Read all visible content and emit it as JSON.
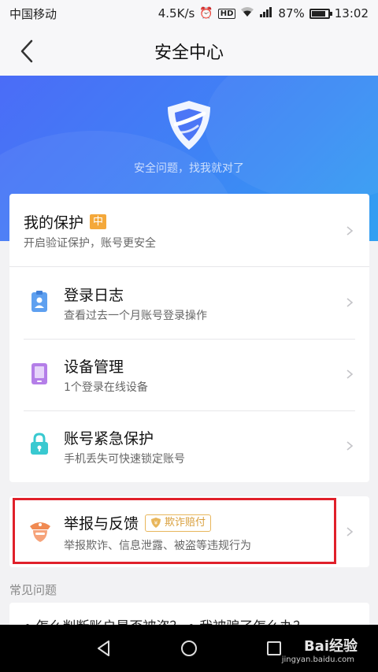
{
  "status_bar": {
    "carrier": "中国移动",
    "speed": "4.5K/s",
    "battery": "87%",
    "time": "13:02"
  },
  "header": {
    "title": "安全中心"
  },
  "hero": {
    "slogan": "安全问题，找我就对了"
  },
  "protection": {
    "title": "我的保护",
    "level_badge": "中",
    "subtitle": "开启验证保护，账号更安全"
  },
  "items": [
    {
      "title": "登录日志",
      "subtitle": "查看过去一个月账号登录操作",
      "icon": "login-log-icon",
      "color": "#5ea0f0"
    },
    {
      "title": "设备管理",
      "subtitle": "1个登录在线设备",
      "icon": "device-icon",
      "color": "#b47ee8"
    },
    {
      "title": "账号紧急保护",
      "subtitle": "手机丢失可快速锁定账号",
      "icon": "lock-icon",
      "color": "#39c9d0"
    }
  ],
  "report": {
    "title": "举报与反馈",
    "badge": "欺诈赔付",
    "subtitle": "举报欺诈、信息泄露、被盗等违规行为",
    "icon": "police-icon"
  },
  "faq": {
    "section_title": "常见问题",
    "preview_text": "• 怎么判断账户是否被盗？  • 我被骗了怎么办？"
  },
  "watermark": {
    "brand": "Bai经验",
    "url": "jingyan.baidu.com"
  },
  "colors": {
    "hero_start": "#4b6cf7",
    "hero_end": "#32a0f2",
    "badge_orange": "#f4a83a",
    "highlight_red": "#e0202a"
  }
}
